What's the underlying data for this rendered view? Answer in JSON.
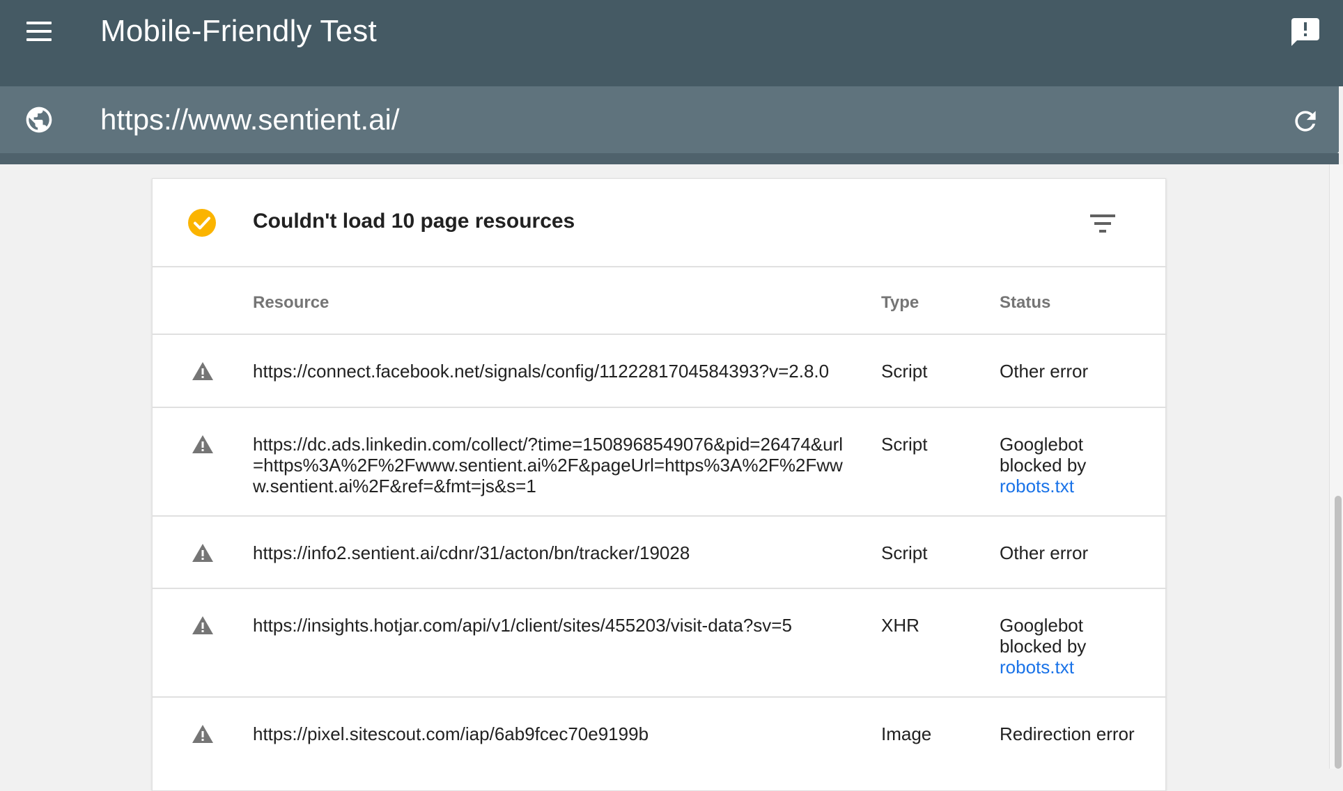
{
  "app": {
    "title": "Mobile-Friendly Test",
    "url": "https://www.sentient.ai/"
  },
  "card": {
    "title": "Couldn't load 10 page resources"
  },
  "table": {
    "headers": {
      "resource": "Resource",
      "type": "Type",
      "status": "Status"
    },
    "rows": [
      {
        "resource": "https://connect.facebook.net/signals/config/1122281704584393?v=2.8.0",
        "type": "Script",
        "status": "Other error",
        "link": ""
      },
      {
        "resource": "https://dc.ads.linkedin.com/collect/?time=1508968549076&pid=26474&url=https%3A%2F%2Fwww.sentient.ai%2F&pageUrl=https%3A%2F%2Fwww.sentient.ai%2F&ref=&fmt=js&s=1",
        "type": "Script",
        "status": "Googlebot blocked by",
        "link": "robots.txt"
      },
      {
        "resource": "https://info2.sentient.ai/cdnr/31/acton/bn/tracker/19028",
        "type": "Script",
        "status": "Other error",
        "link": ""
      },
      {
        "resource": "https://insights.hotjar.com/api/v1/client/sites/455203/visit-data?sv=5",
        "type": "XHR",
        "status": "Googlebot blocked by",
        "link": "robots.txt"
      },
      {
        "resource": "https://pixel.sitescout.com/iap/6ab9fcec70e9199b",
        "type": "Image",
        "status": "Redirection error",
        "link": ""
      }
    ]
  },
  "colors": {
    "appbar": "#455a64",
    "urlbar": "#5f737d",
    "check": "#fbb400",
    "link": "#1a73e8"
  }
}
